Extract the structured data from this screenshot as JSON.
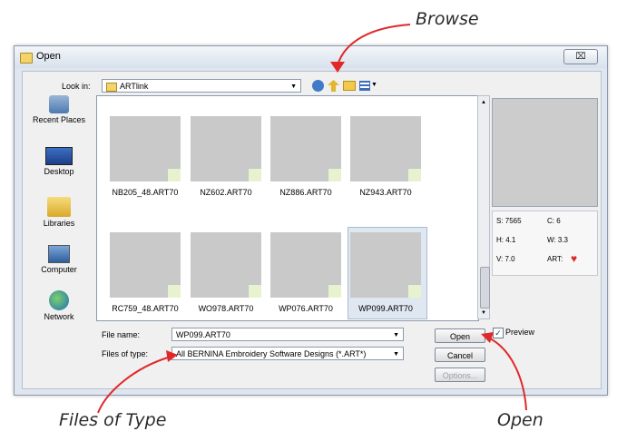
{
  "dialog": {
    "title": "Open",
    "close_glyph": "⌧",
    "look_in_label": "Look in:",
    "look_in_value": "ARTlink"
  },
  "places": [
    {
      "label": "Recent Places",
      "icon": "recent-places-icon"
    },
    {
      "label": "Desktop",
      "icon": "desktop-icon"
    },
    {
      "label": "Libraries",
      "icon": "libraries-icon"
    },
    {
      "label": "Computer",
      "icon": "computer-icon"
    },
    {
      "label": "Network",
      "icon": "network-icon"
    }
  ],
  "files": [
    {
      "name": "NB205_48.ART70"
    },
    {
      "name": "NZ602.ART70"
    },
    {
      "name": "NZ886.ART70"
    },
    {
      "name": "NZ943.ART70"
    },
    {
      "name": "RC759_48.ART70"
    },
    {
      "name": "WO978.ART70"
    },
    {
      "name": "WP076.ART70"
    },
    {
      "name": "WP099.ART70",
      "selected": true
    }
  ],
  "stats": {
    "s": "S: 7565",
    "c": "C: 6",
    "h": "H: 4.1",
    "w": "W: 3.3",
    "v": "V: 7.0",
    "art": "ART:"
  },
  "form": {
    "file_name_label": "File name:",
    "file_name_value": "WP099.ART70",
    "files_of_type_label": "Files of type:",
    "files_of_type_value": "All BERNINA Embroidery Software Designs (*.ART*)"
  },
  "buttons": {
    "open": "Open",
    "cancel": "Cancel",
    "options": "Options..."
  },
  "preview_label": "Preview",
  "preview_checked": true,
  "callouts": {
    "browse": "Browse",
    "files_of_type": "Files of Type",
    "open": "Open"
  },
  "colors": {
    "callout_arrow": "#e0282a",
    "heart": "#d92b2b"
  }
}
